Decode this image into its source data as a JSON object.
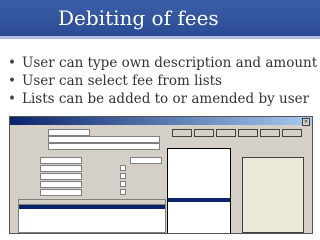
{
  "slide": {
    "title": "Debiting of fees",
    "bullets": [
      "User can type own description and amount",
      "User can select fee from lists",
      "Lists can be added to or amended by user"
    ]
  },
  "accent_color": "#2b4c94"
}
